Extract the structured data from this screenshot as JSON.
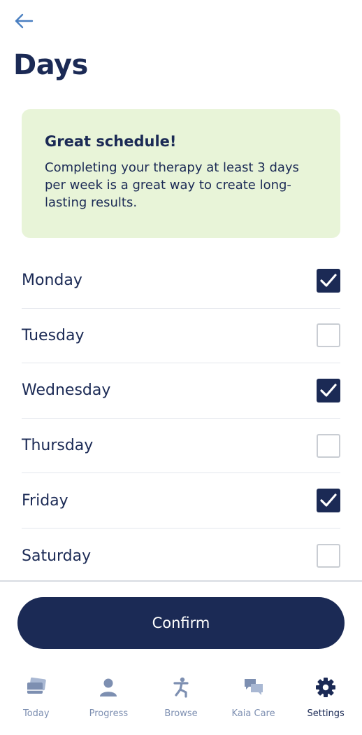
{
  "header": {
    "back_icon": "arrow-left-icon",
    "title": "Days"
  },
  "info_card": {
    "heading": "Great schedule!",
    "text": "Completing your therapy at least 3 days per week is a great way to create long-lasting results."
  },
  "days": [
    {
      "label": "Monday",
      "checked": true
    },
    {
      "label": "Tuesday",
      "checked": false
    },
    {
      "label": "Wednesday",
      "checked": true
    },
    {
      "label": "Thursday",
      "checked": false
    },
    {
      "label": "Friday",
      "checked": true
    },
    {
      "label": "Saturday",
      "checked": false
    }
  ],
  "confirm_label": "Confirm",
  "nav": {
    "items": [
      {
        "label": "Today",
        "icon": "cards-icon",
        "active": false
      },
      {
        "label": "Progress",
        "icon": "person-icon",
        "active": false
      },
      {
        "label": "Browse",
        "icon": "exercise-icon",
        "active": false
      },
      {
        "label": "Kaia Care",
        "icon": "chat-bubbles-icon",
        "active": false
      },
      {
        "label": "Settings",
        "icon": "gear-icon",
        "active": true
      }
    ]
  },
  "colors": {
    "primary": "#1b2a55",
    "card_bg": "#e8f4d8",
    "back_arrow": "#4a7fc1",
    "nav_inactive": "#7d8fb1"
  }
}
